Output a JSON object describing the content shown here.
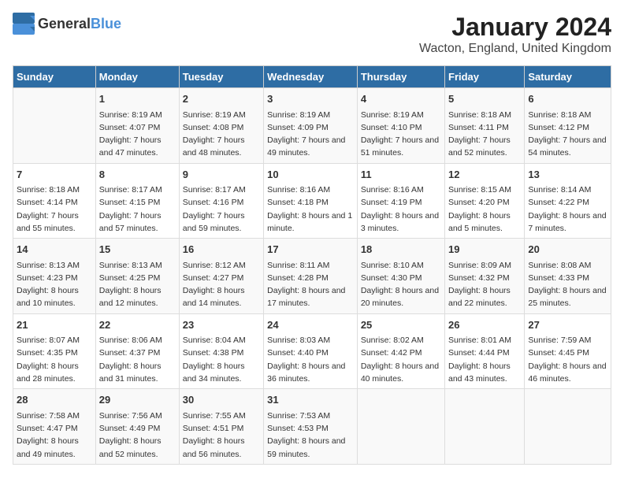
{
  "logo": {
    "text_general": "General",
    "text_blue": "Blue"
  },
  "title": "January 2024",
  "subtitle": "Wacton, England, United Kingdom",
  "weekdays": [
    "Sunday",
    "Monday",
    "Tuesday",
    "Wednesday",
    "Thursday",
    "Friday",
    "Saturday"
  ],
  "weeks": [
    [
      {
        "day": "",
        "sunrise": "",
        "sunset": "",
        "daylight": ""
      },
      {
        "day": "1",
        "sunrise": "Sunrise: 8:19 AM",
        "sunset": "Sunset: 4:07 PM",
        "daylight": "Daylight: 7 hours and 47 minutes."
      },
      {
        "day": "2",
        "sunrise": "Sunrise: 8:19 AM",
        "sunset": "Sunset: 4:08 PM",
        "daylight": "Daylight: 7 hours and 48 minutes."
      },
      {
        "day": "3",
        "sunrise": "Sunrise: 8:19 AM",
        "sunset": "Sunset: 4:09 PM",
        "daylight": "Daylight: 7 hours and 49 minutes."
      },
      {
        "day": "4",
        "sunrise": "Sunrise: 8:19 AM",
        "sunset": "Sunset: 4:10 PM",
        "daylight": "Daylight: 7 hours and 51 minutes."
      },
      {
        "day": "5",
        "sunrise": "Sunrise: 8:18 AM",
        "sunset": "Sunset: 4:11 PM",
        "daylight": "Daylight: 7 hours and 52 minutes."
      },
      {
        "day": "6",
        "sunrise": "Sunrise: 8:18 AM",
        "sunset": "Sunset: 4:12 PM",
        "daylight": "Daylight: 7 hours and 54 minutes."
      }
    ],
    [
      {
        "day": "7",
        "sunrise": "Sunrise: 8:18 AM",
        "sunset": "Sunset: 4:14 PM",
        "daylight": "Daylight: 7 hours and 55 minutes."
      },
      {
        "day": "8",
        "sunrise": "Sunrise: 8:17 AM",
        "sunset": "Sunset: 4:15 PM",
        "daylight": "Daylight: 7 hours and 57 minutes."
      },
      {
        "day": "9",
        "sunrise": "Sunrise: 8:17 AM",
        "sunset": "Sunset: 4:16 PM",
        "daylight": "Daylight: 7 hours and 59 minutes."
      },
      {
        "day": "10",
        "sunrise": "Sunrise: 8:16 AM",
        "sunset": "Sunset: 4:18 PM",
        "daylight": "Daylight: 8 hours and 1 minute."
      },
      {
        "day": "11",
        "sunrise": "Sunrise: 8:16 AM",
        "sunset": "Sunset: 4:19 PM",
        "daylight": "Daylight: 8 hours and 3 minutes."
      },
      {
        "day": "12",
        "sunrise": "Sunrise: 8:15 AM",
        "sunset": "Sunset: 4:20 PM",
        "daylight": "Daylight: 8 hours and 5 minutes."
      },
      {
        "day": "13",
        "sunrise": "Sunrise: 8:14 AM",
        "sunset": "Sunset: 4:22 PM",
        "daylight": "Daylight: 8 hours and 7 minutes."
      }
    ],
    [
      {
        "day": "14",
        "sunrise": "Sunrise: 8:13 AM",
        "sunset": "Sunset: 4:23 PM",
        "daylight": "Daylight: 8 hours and 10 minutes."
      },
      {
        "day": "15",
        "sunrise": "Sunrise: 8:13 AM",
        "sunset": "Sunset: 4:25 PM",
        "daylight": "Daylight: 8 hours and 12 minutes."
      },
      {
        "day": "16",
        "sunrise": "Sunrise: 8:12 AM",
        "sunset": "Sunset: 4:27 PM",
        "daylight": "Daylight: 8 hours and 14 minutes."
      },
      {
        "day": "17",
        "sunrise": "Sunrise: 8:11 AM",
        "sunset": "Sunset: 4:28 PM",
        "daylight": "Daylight: 8 hours and 17 minutes."
      },
      {
        "day": "18",
        "sunrise": "Sunrise: 8:10 AM",
        "sunset": "Sunset: 4:30 PM",
        "daylight": "Daylight: 8 hours and 20 minutes."
      },
      {
        "day": "19",
        "sunrise": "Sunrise: 8:09 AM",
        "sunset": "Sunset: 4:32 PM",
        "daylight": "Daylight: 8 hours and 22 minutes."
      },
      {
        "day": "20",
        "sunrise": "Sunrise: 8:08 AM",
        "sunset": "Sunset: 4:33 PM",
        "daylight": "Daylight: 8 hours and 25 minutes."
      }
    ],
    [
      {
        "day": "21",
        "sunrise": "Sunrise: 8:07 AM",
        "sunset": "Sunset: 4:35 PM",
        "daylight": "Daylight: 8 hours and 28 minutes."
      },
      {
        "day": "22",
        "sunrise": "Sunrise: 8:06 AM",
        "sunset": "Sunset: 4:37 PM",
        "daylight": "Daylight: 8 hours and 31 minutes."
      },
      {
        "day": "23",
        "sunrise": "Sunrise: 8:04 AM",
        "sunset": "Sunset: 4:38 PM",
        "daylight": "Daylight: 8 hours and 34 minutes."
      },
      {
        "day": "24",
        "sunrise": "Sunrise: 8:03 AM",
        "sunset": "Sunset: 4:40 PM",
        "daylight": "Daylight: 8 hours and 36 minutes."
      },
      {
        "day": "25",
        "sunrise": "Sunrise: 8:02 AM",
        "sunset": "Sunset: 4:42 PM",
        "daylight": "Daylight: 8 hours and 40 minutes."
      },
      {
        "day": "26",
        "sunrise": "Sunrise: 8:01 AM",
        "sunset": "Sunset: 4:44 PM",
        "daylight": "Daylight: 8 hours and 43 minutes."
      },
      {
        "day": "27",
        "sunrise": "Sunrise: 7:59 AM",
        "sunset": "Sunset: 4:45 PM",
        "daylight": "Daylight: 8 hours and 46 minutes."
      }
    ],
    [
      {
        "day": "28",
        "sunrise": "Sunrise: 7:58 AM",
        "sunset": "Sunset: 4:47 PM",
        "daylight": "Daylight: 8 hours and 49 minutes."
      },
      {
        "day": "29",
        "sunrise": "Sunrise: 7:56 AM",
        "sunset": "Sunset: 4:49 PM",
        "daylight": "Daylight: 8 hours and 52 minutes."
      },
      {
        "day": "30",
        "sunrise": "Sunrise: 7:55 AM",
        "sunset": "Sunset: 4:51 PM",
        "daylight": "Daylight: 8 hours and 56 minutes."
      },
      {
        "day": "31",
        "sunrise": "Sunrise: 7:53 AM",
        "sunset": "Sunset: 4:53 PM",
        "daylight": "Daylight: 8 hours and 59 minutes."
      },
      {
        "day": "",
        "sunrise": "",
        "sunset": "",
        "daylight": ""
      },
      {
        "day": "",
        "sunrise": "",
        "sunset": "",
        "daylight": ""
      },
      {
        "day": "",
        "sunrise": "",
        "sunset": "",
        "daylight": ""
      }
    ]
  ]
}
